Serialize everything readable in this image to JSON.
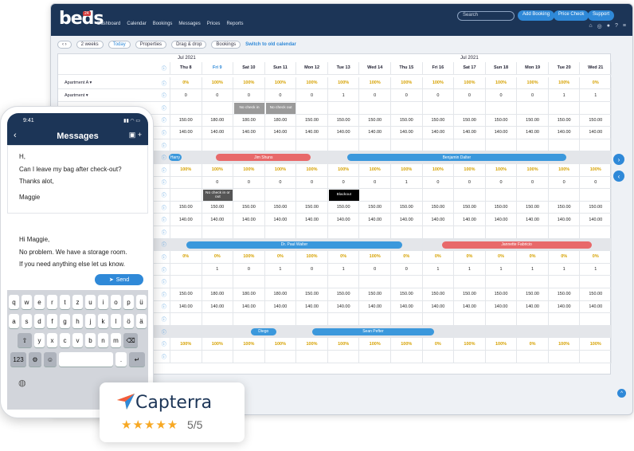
{
  "app": {
    "logo": "beds",
    "logo_badge": "24",
    "nav": [
      "Dashboard",
      "Calendar",
      "Bookings",
      "Messages",
      "Prices",
      "Reports"
    ],
    "search_placeholder": "Search",
    "buttons": [
      "Add Booking",
      "Price Check",
      "Support"
    ]
  },
  "toolbar": {
    "range": "2 weeks",
    "today": "Today",
    "properties": "Properties",
    "dragdrop": "Drag & drop",
    "bookings": "Bookings",
    "switch": "Switch to old calendar"
  },
  "calendar": {
    "month1": "Jul 2021",
    "month2": "Jul 2021",
    "days": [
      "Thu 8",
      "Fri 9",
      "Sat 10",
      "Sun 11",
      "Mon 12",
      "Tue 13",
      "Wed 14",
      "Thu 15",
      "Fri 16",
      "Sat 17",
      "Sun 18",
      "Mon 19",
      "Tue 20",
      "Wed 21"
    ],
    "property_label": "Apartment A",
    "room_label": "Apartment",
    "occupancy1": [
      "0%",
      "100%",
      "100%",
      "100%",
      "100%",
      "100%",
      "100%",
      "100%",
      "100%",
      "100%",
      "100%",
      "100%",
      "100%",
      "0%"
    ],
    "avail1": [
      "0",
      "0",
      "0",
      "0",
      "0",
      "1",
      "0",
      "0",
      "0",
      "0",
      "0",
      "0",
      "1",
      "1"
    ],
    "price1a": [
      "150.00",
      "180.00",
      "180.00",
      "180.00",
      "150.00",
      "150.00",
      "150.00",
      "150.00",
      "150.00",
      "150.00",
      "150.00",
      "150.00",
      "150.00",
      "150.00"
    ],
    "price1b": [
      "140.00",
      "140.00",
      "140.00",
      "140.00",
      "140.00",
      "140.00",
      "140.00",
      "140.00",
      "140.00",
      "140.00",
      "140.00",
      "140.00",
      "140.00",
      "140.00"
    ],
    "occupancy2": [
      "100%",
      "100%",
      "100%",
      "100%",
      "100%",
      "100%",
      "100%",
      "100%",
      "100%",
      "100%",
      "100%",
      "100%",
      "100%",
      "100%"
    ],
    "avail2": [
      "",
      "0",
      "0",
      "0",
      "0",
      "0",
      "0",
      "1",
      "0",
      "0",
      "0",
      "0",
      "0",
      "0"
    ],
    "price2a": [
      "150.00",
      "150.00",
      "150.00",
      "150.00",
      "150.00",
      "150.00",
      "150.00",
      "150.00",
      "150.00",
      "150.00",
      "150.00",
      "150.00",
      "150.00",
      "150.00"
    ],
    "price2b": [
      "140.00",
      "140.00",
      "140.00",
      "140.00",
      "140.00",
      "140.00",
      "140.00",
      "140.00",
      "140.00",
      "140.00",
      "140.00",
      "140.00",
      "140.00",
      "140.00"
    ],
    "occupancy3": [
      "0%",
      "0%",
      "100%",
      "0%",
      "100%",
      "0%",
      "100%",
      "0%",
      "0%",
      "0%",
      "0%",
      "0%",
      "0%",
      "0%"
    ],
    "avail3": [
      "",
      "1",
      "0",
      "1",
      "0",
      "1",
      "0",
      "0",
      "1",
      "1",
      "1",
      "1",
      "1",
      "1"
    ],
    "price3a": [
      "150.00",
      "180.00",
      "180.00",
      "180.00",
      "150.00",
      "150.00",
      "150.00",
      "150.00",
      "150.00",
      "150.00",
      "150.00",
      "150.00",
      "150.00",
      "150.00"
    ],
    "price3b": [
      "140.00",
      "140.00",
      "140.00",
      "140.00",
      "140.00",
      "140.00",
      "140.00",
      "140.00",
      "140.00",
      "140.00",
      "140.00",
      "140.00",
      "140.00",
      "140.00"
    ],
    "occupancy4": [
      "100%",
      "100%",
      "100%",
      "100%",
      "100%",
      "100%",
      "100%",
      "100%",
      "0%",
      "100%",
      "100%",
      "0%",
      "100%",
      "100%"
    ],
    "blocks": {
      "nocheckin": "No check in",
      "nocheckout": "No check out",
      "nocheckinout": "No check in or out",
      "blackout": "Blackout"
    },
    "bookings": [
      "Harry",
      "Jim Shuns",
      "Benjamin Dalter",
      "Dr. Paul Walter",
      "Jannette Fabricio",
      "Diego",
      "Sean Pefter"
    ],
    "colors": {
      "red": "#e8696a",
      "blue": "#3b98dc",
      "navy": "#1c3557",
      "accent": "#2f89d8"
    }
  },
  "phone": {
    "time": "9:41",
    "title": "Messages",
    "msg1": [
      "H,",
      "Can I leave my bag after check-out?",
      "Thanks alot,",
      "",
      "Maggie"
    ],
    "msg2": [
      "Hi Maggie,",
      "No problem. We have a storage room.",
      "If you need anything else let us know."
    ],
    "send": "Send",
    "keys_row1": [
      "q",
      "w",
      "e",
      "r",
      "t",
      "z",
      "u",
      "i",
      "o",
      "p",
      "ü"
    ],
    "keys_row2": [
      "a",
      "s",
      "d",
      "f",
      "g",
      "h",
      "j",
      "k",
      "l",
      "ö",
      "ä"
    ],
    "keys_row3": [
      "y",
      "x",
      "c",
      "v",
      "b",
      "n",
      "m"
    ],
    "key_123": "123",
    "key_dot": "."
  },
  "capterra": {
    "name": "Capterra",
    "stars": "★★★★★",
    "score": "5/5"
  }
}
